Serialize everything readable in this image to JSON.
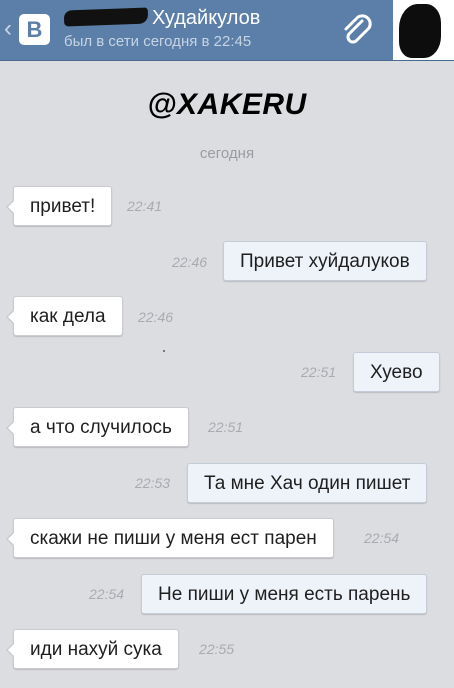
{
  "header": {
    "logo_letter": "В",
    "contact_name": "Худайкулов",
    "status": "был в сети сегодня в 22:45",
    "attach_icon": "paperclip-icon",
    "back_icon": "chevron-left-icon"
  },
  "watermark": "@XAKERU",
  "date_separator": "сегодня",
  "messages": [
    {
      "direction": "in",
      "text": "привет!",
      "time": "22:41"
    },
    {
      "direction": "out",
      "text": "Привет хуйдалуков",
      "time": "22:46"
    },
    {
      "direction": "in",
      "text": "как дела",
      "time": "22:46"
    },
    {
      "direction": "out",
      "text": "Хуево",
      "time": "22:51"
    },
    {
      "direction": "in",
      "text": "а что случилось",
      "time": "22:51"
    },
    {
      "direction": "out",
      "text": "Та мне Хач один пишет",
      "time": "22:53"
    },
    {
      "direction": "in",
      "text": "скажи не пиши у меня ест парен",
      "time": "22:54"
    },
    {
      "direction": "out",
      "text": "Не пиши у меня есть парень",
      "time": "22:54"
    },
    {
      "direction": "in",
      "text": "иди нахуй сука",
      "time": "22:55"
    }
  ],
  "colors": {
    "header": "#5b7fa8",
    "background": "#dcdde0",
    "bubble_in": "#ffffff",
    "bubble_out": "#eef3fa",
    "timestamp": "#a9abb0"
  }
}
